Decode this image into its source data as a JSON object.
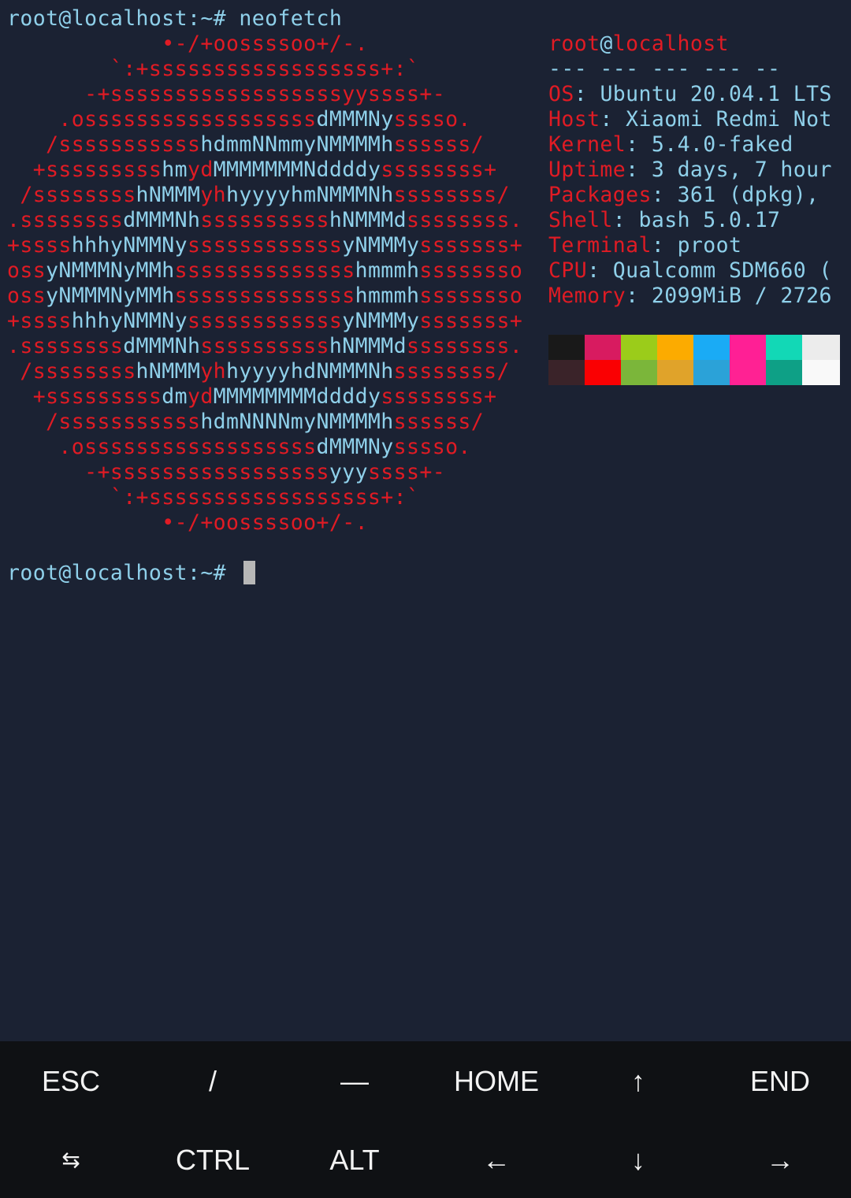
{
  "colors": {
    "background": "#1b2233",
    "ascii_red": "#e01b24",
    "ascii_cyan": "#8fd0ea",
    "text": "#8fd0ea",
    "cursor": "#b7b7b7",
    "keys_background": "#0f1114",
    "keys_text": "#f2f2f2"
  },
  "terminal": {
    "command_prompt": "root@localhost:~# ",
    "command": "neofetch",
    "prompt": "root@localhost:~# "
  },
  "ascii_logo": [
    [
      [
        "r",
        "            •-/+oossssoo+/-."
      ]
    ],
    [
      [
        "r",
        "        `:+ssssssssssssssssss+:`"
      ]
    ],
    [
      [
        "r",
        "      -+ssssssssssssssssssyyssss+-"
      ]
    ],
    [
      [
        "r",
        "    .ossssssssssssssssss"
      ],
      [
        "c",
        "dMMMNy"
      ],
      [
        "r",
        "sssso."
      ]
    ],
    [
      [
        "r",
        "   /sssssssssss"
      ],
      [
        "c",
        "hdmmNNmmyNMMMMh"
      ],
      [
        "r",
        "ssssss/"
      ]
    ],
    [
      [
        "r",
        "  +sssssssss"
      ],
      [
        "c",
        "hm"
      ],
      [
        "r",
        "yd"
      ],
      [
        "c",
        "MMMMMMMNddddy"
      ],
      [
        "r",
        "ssssssss+"
      ]
    ],
    [
      [
        "r",
        " /ssssssss"
      ],
      [
        "c",
        "hNMMM"
      ],
      [
        "r",
        "yh"
      ],
      [
        "c",
        "hyyyyhmNMMMNh"
      ],
      [
        "r",
        "ssssssss/"
      ]
    ],
    [
      [
        "r",
        ".ssssssss"
      ],
      [
        "c",
        "dMMMNh"
      ],
      [
        "r",
        "ssssssssss"
      ],
      [
        "c",
        "hNMMMd"
      ],
      [
        "r",
        "ssssssss."
      ]
    ],
    [
      [
        "r",
        "+ssss"
      ],
      [
        "c",
        "hhhyNMMNy"
      ],
      [
        "r",
        "ssssssssssss"
      ],
      [
        "c",
        "yNMMMy"
      ],
      [
        "r",
        "sssssss+"
      ]
    ],
    [
      [
        "r",
        "oss"
      ],
      [
        "c",
        "yNMMMNyMMh"
      ],
      [
        "r",
        "ssssssssssssss"
      ],
      [
        "c",
        "hmmmh"
      ],
      [
        "r",
        "ssssssso"
      ]
    ],
    [
      [
        "r",
        "oss"
      ],
      [
        "c",
        "yNMMMNyMMh"
      ],
      [
        "r",
        "ssssssssssssss"
      ],
      [
        "c",
        "hmmmh"
      ],
      [
        "r",
        "ssssssso"
      ]
    ],
    [
      [
        "r",
        "+ssss"
      ],
      [
        "c",
        "hhhyNMMNy"
      ],
      [
        "r",
        "ssssssssssss"
      ],
      [
        "c",
        "yNMMMy"
      ],
      [
        "r",
        "sssssss+"
      ]
    ],
    [
      [
        "r",
        ".ssssssss"
      ],
      [
        "c",
        "dMMMNh"
      ],
      [
        "r",
        "ssssssssss"
      ],
      [
        "c",
        "hNMMMd"
      ],
      [
        "r",
        "ssssssss."
      ]
    ],
    [
      [
        "r",
        " /ssssssss"
      ],
      [
        "c",
        "hNMMM"
      ],
      [
        "r",
        "yh"
      ],
      [
        "c",
        "hyyyyhdNMMMNh"
      ],
      [
        "r",
        "ssssssss/"
      ]
    ],
    [
      [
        "r",
        "  +sssssssss"
      ],
      [
        "c",
        "dm"
      ],
      [
        "r",
        "yd"
      ],
      [
        "c",
        "MMMMMMMMddddy"
      ],
      [
        "r",
        "ssssssss+"
      ]
    ],
    [
      [
        "r",
        "   /sssssssssss"
      ],
      [
        "c",
        "hdmNNNNmyNMMMMh"
      ],
      [
        "r",
        "ssssss/"
      ]
    ],
    [
      [
        "r",
        "    .ossssssssssssssssss"
      ],
      [
        "c",
        "dMMMNy"
      ],
      [
        "r",
        "sssso."
      ]
    ],
    [
      [
        "r",
        "      -+sssssssssssssssss"
      ],
      [
        "c",
        "yyy"
      ],
      [
        "r",
        "ssss+-"
      ]
    ],
    [
      [
        "r",
        "        `:+ssssssssssssssssss+:`"
      ]
    ],
    [
      [
        "r",
        "            •-/+oossssoo+/-."
      ]
    ]
  ],
  "system_info": {
    "user": "root",
    "at": "@",
    "host": "localhost",
    "separator": "--- --- --- --- --",
    "fields": [
      {
        "key": "OS",
        "value": "Ubuntu 20.04.1 LTS"
      },
      {
        "key": "Host",
        "value": "Xiaomi Redmi Not"
      },
      {
        "key": "Kernel",
        "value": "5.4.0-faked"
      },
      {
        "key": "Uptime",
        "value": "3 days, 7 hour"
      },
      {
        "key": "Packages",
        "value": "361 (dpkg),"
      },
      {
        "key": "Shell",
        "value": "bash 5.0.17"
      },
      {
        "key": "Terminal",
        "value": "proot"
      },
      {
        "key": "CPU",
        "value": "Qualcomm SDM660 ("
      },
      {
        "key": "Memory",
        "value": "2099MiB / 2726"
      }
    ]
  },
  "palette": {
    "normal": [
      "#191919",
      "#d81b60",
      "#9bcc1a",
      "#fcab00",
      "#1aabf5",
      "#ff1f95",
      "#12d8b6",
      "#ececec"
    ],
    "bright": [
      "#3a2329",
      "#fa0002",
      "#7bb63a",
      "#e0a32a",
      "#2ba2d8",
      "#ff2293",
      "#0ea086",
      "#f9f9f9"
    ]
  },
  "extra_keys": [
    {
      "label": "ESC",
      "name": "esc-key"
    },
    {
      "label": "/",
      "name": "slash-key"
    },
    {
      "label": "—",
      "name": "dash-key"
    },
    {
      "label": "HOME",
      "name": "home-key"
    },
    {
      "label": "↑",
      "name": "arrow-up-key"
    },
    {
      "label": "END",
      "name": "end-key"
    },
    {
      "label": "⇆",
      "name": "tab-key",
      "icon": "tab-arrows-icon"
    },
    {
      "label": "CTRL",
      "name": "ctrl-key"
    },
    {
      "label": "ALT",
      "name": "alt-key"
    },
    {
      "label": "←",
      "name": "arrow-left-key"
    },
    {
      "label": "↓",
      "name": "arrow-down-key"
    },
    {
      "label": "→",
      "name": "arrow-right-key"
    }
  ]
}
